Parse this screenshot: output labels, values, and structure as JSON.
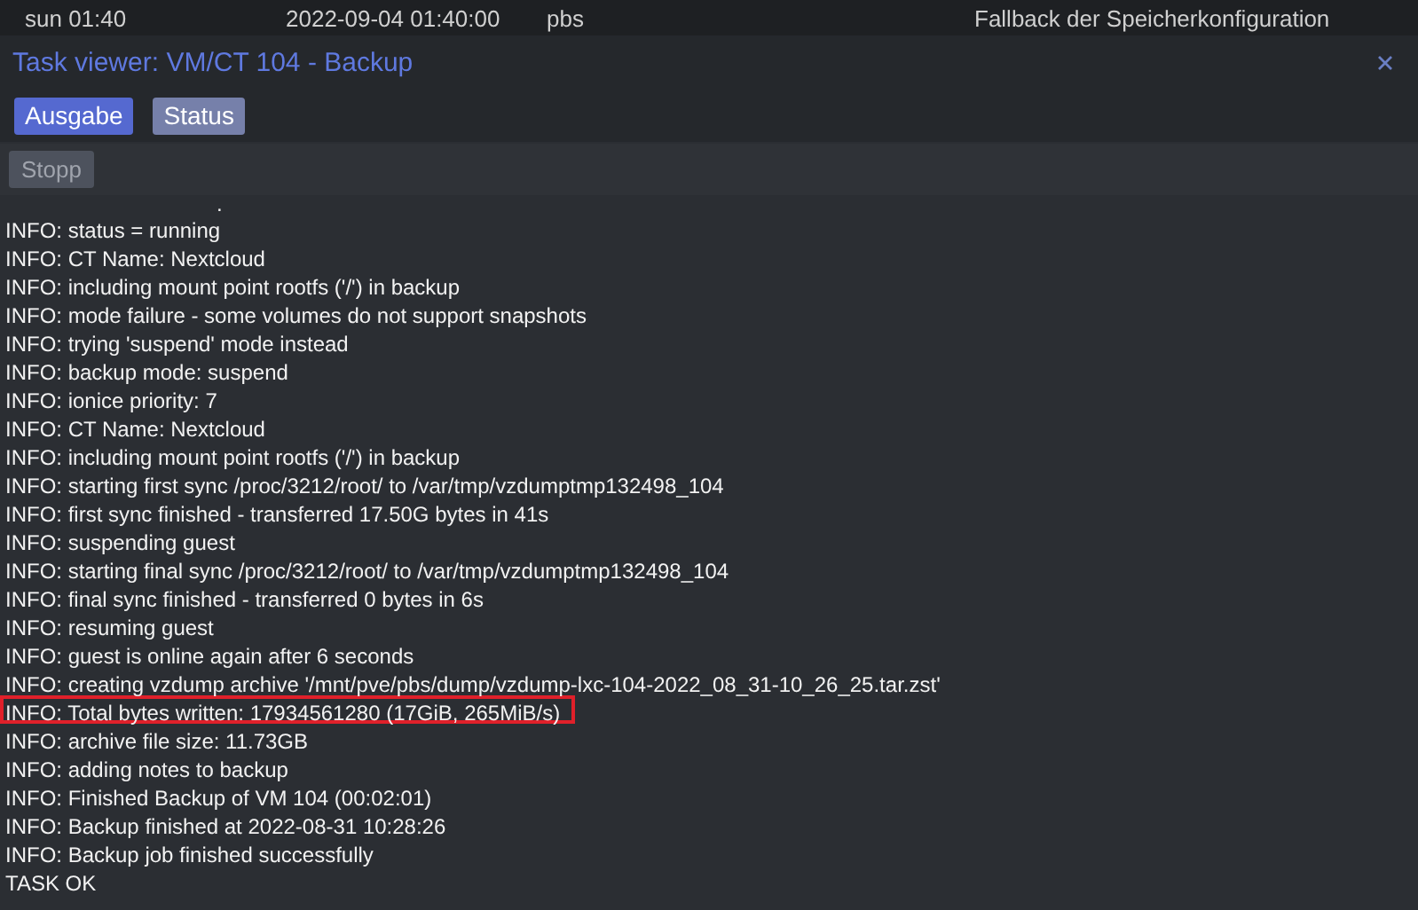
{
  "background_row": {
    "cells": [
      "sun 01:40",
      "2022-09-04 01:40:00",
      "pbs",
      "Fallback der Speicherkonfiguration"
    ]
  },
  "window": {
    "title": "Task viewer: VM/CT 104 - Backup"
  },
  "tabs": [
    {
      "label": "Ausgabe",
      "selected": true
    },
    {
      "label": "Status",
      "selected": false
    }
  ],
  "toolbar": {
    "buttons": [
      {
        "label": "Stopp",
        "disabled": true
      }
    ]
  },
  "log": [
    {
      "text": ".",
      "highlighted": false
    },
    {
      "text": "INFO: status = running",
      "highlighted": false
    },
    {
      "text": "INFO: CT Name: Nextcloud",
      "highlighted": false
    },
    {
      "text": "INFO: including mount point rootfs ('/') in backup",
      "highlighted": false
    },
    {
      "text": "INFO: mode failure - some volumes do not support snapshots",
      "highlighted": false
    },
    {
      "text": "INFO: trying 'suspend' mode instead",
      "highlighted": false
    },
    {
      "text": "INFO: backup mode: suspend",
      "highlighted": false
    },
    {
      "text": "INFO: ionice priority: 7",
      "highlighted": false
    },
    {
      "text": "INFO: CT Name: Nextcloud",
      "highlighted": false
    },
    {
      "text": "INFO: including mount point rootfs ('/') in backup",
      "highlighted": false
    },
    {
      "text": "INFO: starting first sync /proc/3212/root/ to /var/tmp/vzdumptmp132498_104",
      "highlighted": false
    },
    {
      "text": "INFO: first sync finished - transferred 17.50G bytes in 41s",
      "highlighted": false
    },
    {
      "text": "INFO: suspending guest",
      "highlighted": false
    },
    {
      "text": "INFO: starting final sync /proc/3212/root/ to /var/tmp/vzdumptmp132498_104",
      "highlighted": false
    },
    {
      "text": "INFO: final sync finished - transferred 0 bytes in 6s",
      "highlighted": false
    },
    {
      "text": "INFO: resuming guest",
      "highlighted": false
    },
    {
      "text": "INFO: guest is online again after 6 seconds",
      "highlighted": false
    },
    {
      "text": "INFO: creating vzdump archive '/mnt/pve/pbs/dump/vzdump-lxc-104-2022_08_31-10_26_25.tar.zst'",
      "highlighted": false
    },
    {
      "text": "INFO: Total bytes written: 17934561280 (17GiB, 265MiB/s)",
      "highlighted": true
    },
    {
      "text": "INFO: archive file size: 11.73GB",
      "highlighted": false
    },
    {
      "text": "INFO: adding notes to backup",
      "highlighted": false
    },
    {
      "text": "INFO: Finished Backup of VM 104 (00:02:01)",
      "highlighted": false
    },
    {
      "text": "INFO: Backup finished at 2022-08-31 10:28:26",
      "highlighted": false
    },
    {
      "text": "INFO: Backup job finished successfully",
      "highlighted": false
    },
    {
      "text": "TASK OK",
      "highlighted": false
    }
  ]
}
